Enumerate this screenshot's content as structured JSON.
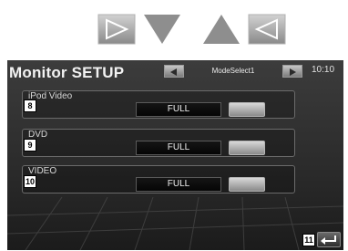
{
  "header": {
    "title": "Monitor SETUP",
    "mode_label": "ModeSelect1",
    "clock": "10:10"
  },
  "rows": [
    {
      "label": "iPod Video",
      "value": "FULL",
      "callout": "8"
    },
    {
      "label": "DVD",
      "value": "FULL",
      "callout": "9"
    },
    {
      "label": "VIDEO",
      "value": "FULL",
      "callout": "10"
    }
  ],
  "return_callout": "11",
  "icons": {
    "nav_right": "right-triangle-icon",
    "nav_down": "down-triangle-icon",
    "nav_up": "up-triangle-icon",
    "nav_left": "left-triangle-icon",
    "mode_prev": "left-arrow-icon",
    "mode_next": "right-arrow-icon",
    "return": "return-arrow-icon"
  },
  "colors": {
    "panel": "#2e2e2e",
    "nav_gray": "#9e9e9e",
    "text": "#f2f2f2"
  }
}
